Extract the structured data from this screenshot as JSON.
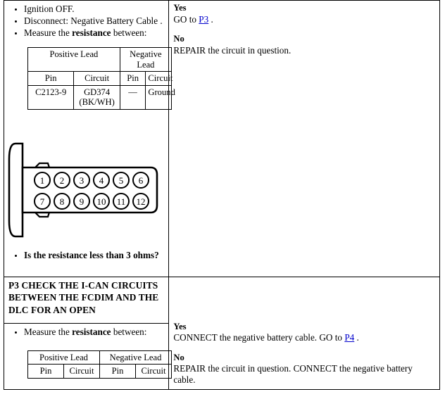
{
  "document": {
    "type": "pinpoint-test-procedure",
    "link_color": "#0000cc"
  },
  "step_p2": {
    "instructions": [
      {
        "text": "Ignition OFF.",
        "bold_parts": []
      },
      {
        "text": "Disconnect: Negative Battery Cable .",
        "bold_parts": []
      },
      {
        "pre": "Measure the ",
        "bold": "resistance",
        "post": " between:"
      }
    ],
    "lead_table": {
      "group_headers": [
        "Positive Lead",
        "Negative Lead"
      ],
      "columns": [
        "Pin",
        "Circuit",
        "Pin",
        "Circuit"
      ],
      "rows": [
        [
          "C2123-9",
          "GD374 (BK/WH)",
          "—",
          "Ground"
        ]
      ]
    },
    "connector": {
      "name": "12-pin-connector",
      "pin_rows": [
        [
          "1",
          "2",
          "3",
          "4",
          "5",
          "6"
        ],
        [
          "7",
          "8",
          "9",
          "10",
          "11",
          "12"
        ]
      ]
    },
    "question": "Is the resistance less than 3 ohms?",
    "answers": [
      {
        "key": "Yes",
        "pre": "GO to ",
        "link": "P3",
        "post": " ."
      },
      {
        "key": "No",
        "pre": "REPAIR the circuit in question.",
        "link": "",
        "post": ""
      }
    ]
  },
  "step_p3": {
    "heading": "P3 CHECK THE I-CAN CIRCUITS BETWEEN THE FCDIM AND THE DLC FOR AN OPEN",
    "instructions": [
      {
        "pre": "Measure the ",
        "bold": "resistance",
        "post": " between:"
      }
    ],
    "lead_table": {
      "group_headers": [
        "Positive Lead",
        "Negative Lead"
      ],
      "columns": [
        "Pin",
        "Circuit",
        "Pin",
        "Circuit"
      ],
      "rows": []
    },
    "answers": [
      {
        "key": "Yes",
        "pre": "CONNECT the negative battery cable. GO to ",
        "link": "P4",
        "post": " ."
      },
      {
        "key": "No",
        "pre": "REPAIR the circuit in question. CONNECT the negative battery cable.",
        "link": "",
        "post": ""
      }
    ]
  }
}
